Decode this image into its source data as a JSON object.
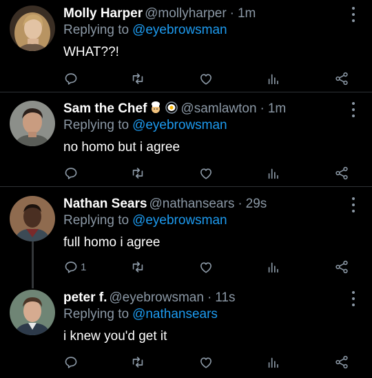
{
  "tweets": [
    {
      "name": "Molly Harper",
      "handle": "@mollyharper",
      "time": "1m",
      "replying_prefix": "Replying to",
      "replying_to": "@eyebrowsman",
      "text": "WHAT??!",
      "reply_count": ""
    },
    {
      "name": "Sam the Chef",
      "emojis": [
        "chef-emoji",
        "fried-egg-emoji"
      ],
      "handle": "@samlawton",
      "time": "1m",
      "replying_prefix": "Replying to",
      "replying_to": "@eyebrowsman",
      "text": "no homo but i agree",
      "reply_count": ""
    },
    {
      "name": "Nathan Sears",
      "handle": "@nathansears",
      "time": "29s",
      "replying_prefix": "Replying to",
      "replying_to": "@eyebrowsman",
      "text": "full homo i agree",
      "reply_count": "1"
    },
    {
      "name": "peter f.",
      "handle": "@eyebrowsman",
      "time": "11s",
      "replying_prefix": "Replying to",
      "replying_to": "@nathansears",
      "text": "i knew you'd get it",
      "reply_count": ""
    }
  ],
  "separator": "·",
  "colors": {
    "background": "#000000",
    "text": "#ffffff",
    "muted": "#8b98a5",
    "link": "#1d9bf0",
    "divider": "#2f3336"
  },
  "icons": [
    "reply-icon",
    "retweet-icon",
    "like-icon",
    "analytics-icon",
    "share-icon",
    "more-icon"
  ]
}
